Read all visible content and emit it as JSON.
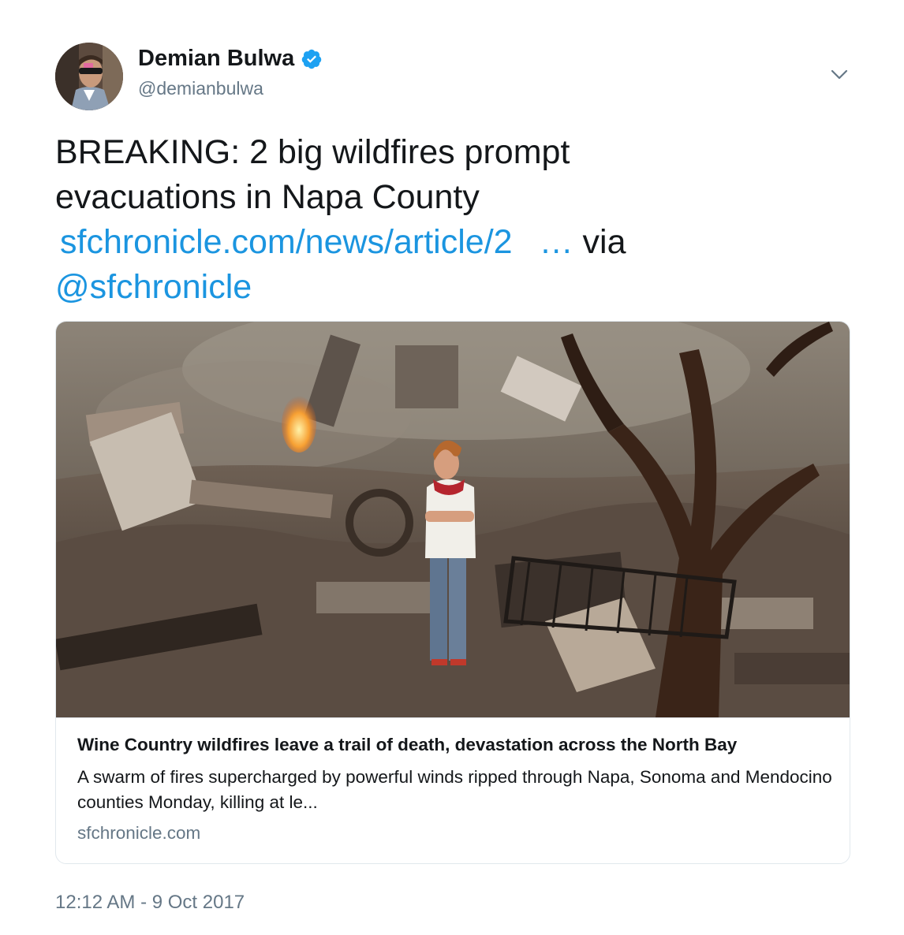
{
  "user": {
    "display_name": "Demian Bulwa",
    "handle": "@demianbulwa",
    "verified": true,
    "avatar_icon": "avatar-photo"
  },
  "menu": {
    "caret_icon": "chevron-down-icon"
  },
  "tweet": {
    "line1": "BREAKING: 2 big wildfires prompt",
    "line2": "evacuations in Napa County",
    "link_text": "sfchronicle.com/news/article/2",
    "link_ellipsis": "…",
    "via_text": " via",
    "mention": "@sfchronicle"
  },
  "card": {
    "image_icon": "wildfire-aftermath-photo",
    "title": "Wine Country wildfires leave a trail of death, devastation across the North Bay",
    "description": "A swarm of fires supercharged by powerful winds ripped through Napa, Sonoma and Mendocino counties Monday, killing at le...",
    "domain": "sfchronicle.com"
  },
  "timestamp": "12:12 AM - 9 Oct 2017",
  "colors": {
    "link": "#1b95e0",
    "text": "#14171a",
    "secondary": "#657786",
    "border": "#e1e8ed"
  }
}
